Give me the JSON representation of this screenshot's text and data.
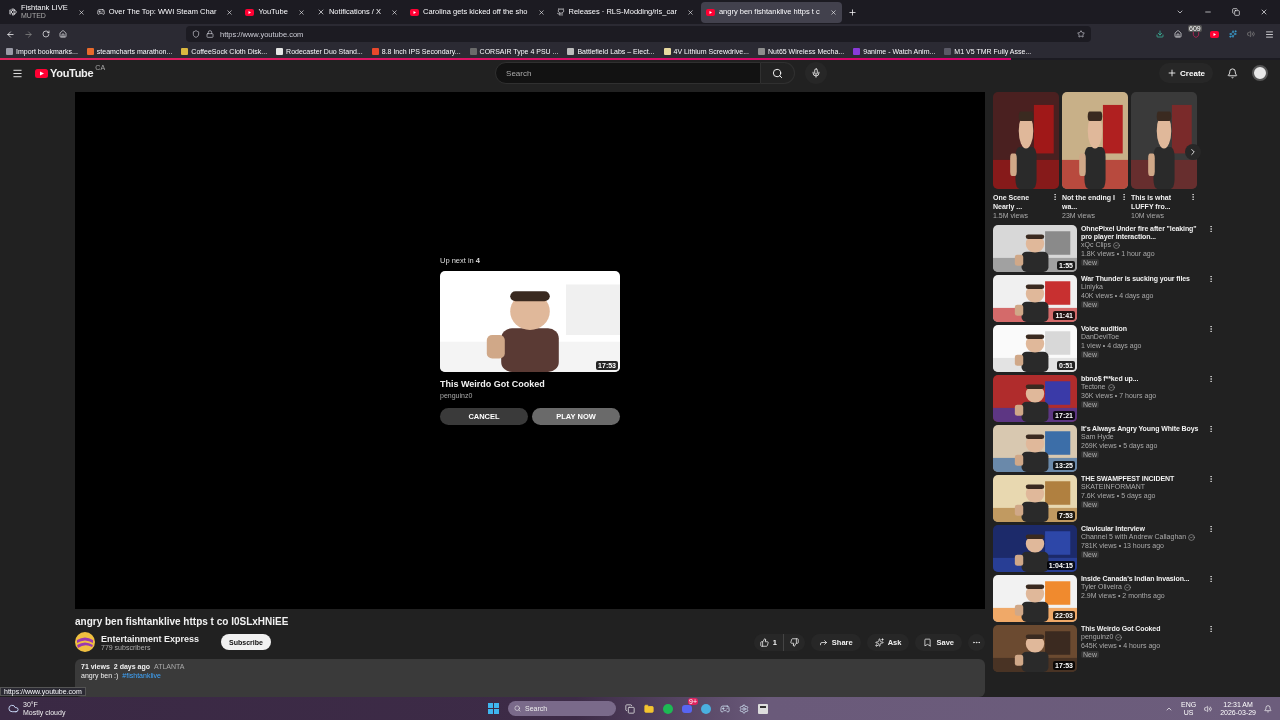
{
  "browser": {
    "tabs": [
      {
        "title": "Fishtank LIVE",
        "subtitle": "MUTED",
        "kind": "fish",
        "selected": false
      },
      {
        "title": "Over The Top: WWI Steam Char",
        "kind": "steam",
        "selected": false
      },
      {
        "title": "YouTube",
        "kind": "youtube",
        "selected": false
      },
      {
        "title": "Notifications / X",
        "kind": "x",
        "selected": false
      },
      {
        "title": "Carolina gets kicked off the sho",
        "kind": "youtube",
        "selected": false
      },
      {
        "title": "Releases · RLS-Modding/rls_car",
        "kind": "github",
        "selected": false
      },
      {
        "title": "angry ben fishtanklive https t c",
        "kind": "youtube",
        "selected": true
      }
    ],
    "url": "https://www.youtube.com",
    "extension_badge": "609",
    "bookmarks": [
      {
        "label": "Import bookmarks...",
        "color": "#9a9aa6"
      },
      {
        "label": "steamcharts marathon...",
        "color": "#e86a2c"
      },
      {
        "label": "CoffeeSock Cloth Disk...",
        "color": "#d9b640"
      },
      {
        "label": "Rodecaster Duo Stand...",
        "color": "#e6e6e6"
      },
      {
        "label": "8.8 Inch IPS Secondary...",
        "color": "#e8482c"
      },
      {
        "label": "CORSAIR Type 4 PSU ...",
        "color": "#6a6a6a"
      },
      {
        "label": "Battlefield Labs – Elect...",
        "color": "#bcbcbc"
      },
      {
        "label": "4V Lithium Screwdrive...",
        "color": "#e8d9a0"
      },
      {
        "label": "Nut65 Wireless Mecha...",
        "color": "#8d8d8d"
      },
      {
        "label": "9anime - Watch Anim...",
        "color": "#8a3ad8"
      },
      {
        "label": "M1 V5 TMR Fully Asse...",
        "color": "#5a5966"
      }
    ],
    "loading_bar": {
      "level": 0.79
    },
    "status_url": "https://www.youtube.com"
  },
  "youtube": {
    "logo": "YouTube",
    "region": "CA",
    "search_placeholder": "Search",
    "create": "Create"
  },
  "up_next": {
    "label": "Up next in **4**",
    "title": "This Weirdo Got Cooked",
    "channel": "penguinz0",
    "duration": "17:53",
    "cancel": "CANCEL",
    "play": "PLAY NOW"
  },
  "video": {
    "title": "angry ben fishtanklive https t co I0SLxHNiEE",
    "channel": "Entertainment Express",
    "subscribers": "779 subscribers",
    "subscribe": "Subscribe",
    "likes": "1",
    "share": "Share",
    "ask": "Ask",
    "save": "Save",
    "views": "71 views",
    "age": "2 days ago",
    "location": "ATLANTA",
    "description": "angry ben :)",
    "hashtag": "#fishtanklive"
  },
  "shorts": [
    {
      "title": "One Scene Nearly ...",
      "views": "1.5M views"
    },
    {
      "title": "Not the ending I wa...",
      "views": "23M views"
    },
    {
      "title": "This is what LUFFY fro...",
      "views": "10M views"
    }
  ],
  "recommendations": [
    {
      "title": "OhnePixel Under fire after \"leaking\" pro player interaction...",
      "channel": "xQc Clips",
      "verified": true,
      "meta": "1.8K views • 1 hour ago",
      "badge": "New",
      "duration": "1:55"
    },
    {
      "title": "War Thunder is sucking your files",
      "channel": "Liniyka",
      "verified": false,
      "meta": "40K views • 4 days ago",
      "badge": "New",
      "duration": "11:41"
    },
    {
      "title": "Voice audition",
      "channel": "DanDeviToe",
      "verified": false,
      "meta": "1 view • 4 days ago",
      "badge": "New",
      "duration": "0:51"
    },
    {
      "title": "bbno$ f**ked up...",
      "channel": "Tectone",
      "verified": true,
      "meta": "36K views • 7 hours ago",
      "badge": "New",
      "duration": "17:21"
    },
    {
      "title": "It's Always Angry Young White Boys",
      "channel": "Sam Hyde",
      "verified": false,
      "meta": "269K views • 5 days ago",
      "badge": "New",
      "duration": "13:25"
    },
    {
      "title": "THE SWAMPFEST INCIDENT",
      "channel": "SKATEINFORMANT",
      "verified": false,
      "meta": "7.6K views • 5 days ago",
      "badge": "New",
      "duration": "7:53"
    },
    {
      "title": "Clavicular Interview",
      "channel": "Channel 5 with Andrew Callaghan",
      "verified": true,
      "meta": "781K views • 13 hours ago",
      "badge": "New",
      "duration": "1:04:15"
    },
    {
      "title": "Inside Canada's Indian Invasion...",
      "channel": "Tyler Oliveira",
      "verified": true,
      "meta": "2.9M views • 2 months ago",
      "duration": "22:03"
    },
    {
      "title": "This Weirdo Got Cooked",
      "channel": "penguinz0",
      "verified": true,
      "meta": "645K views • 4 hours ago",
      "badge": "New",
      "duration": "17:53"
    }
  ],
  "taskbar": {
    "temperature": "30°F",
    "weather": "Mostly cloudy",
    "search_placeholder": "Search",
    "discord_badge": "9+",
    "lang": "ENG",
    "region": "US",
    "time": "12:31 AM",
    "date": "2026-03-29"
  }
}
